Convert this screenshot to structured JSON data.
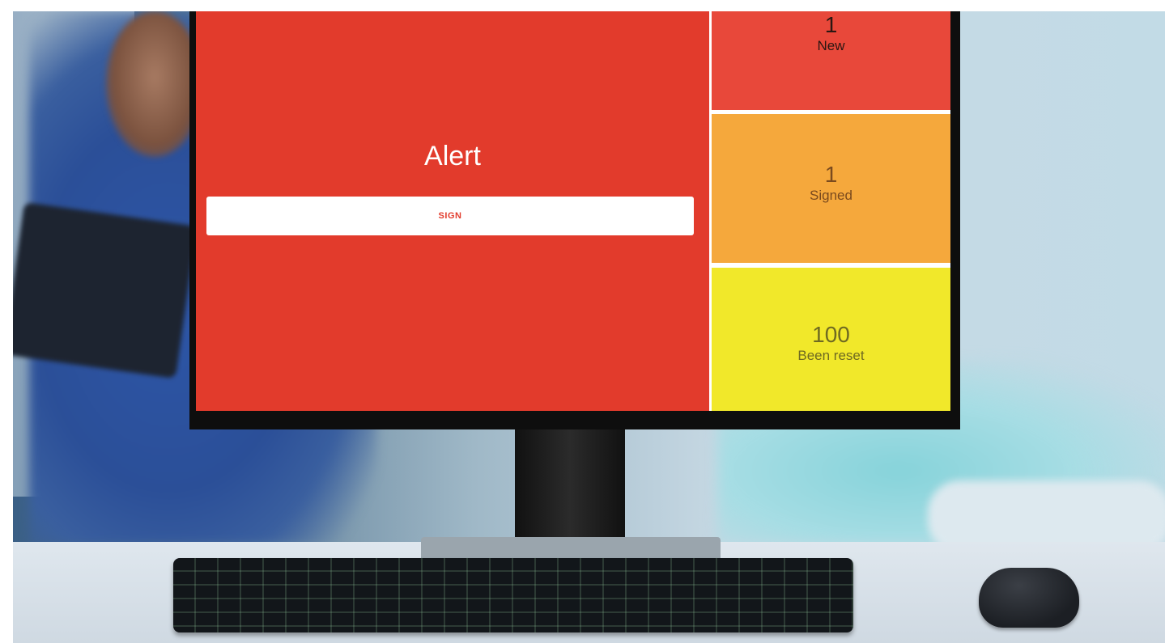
{
  "alert": {
    "title": "Alert",
    "sign_label": "SIGN"
  },
  "tiles": [
    {
      "count": "1",
      "label": "New",
      "color": "#e8483a"
    },
    {
      "count": "1",
      "label": "Signed",
      "color": "#f5a83c"
    },
    {
      "count": "100",
      "label": "Been reset",
      "color": "#f1e82a"
    }
  ],
  "colors": {
    "alert_red": "#e23b2c"
  }
}
